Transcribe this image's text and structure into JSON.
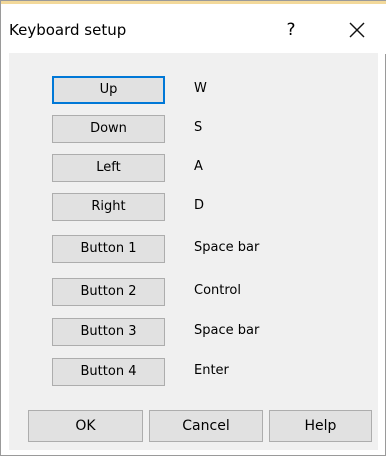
{
  "window": {
    "title": "Keyboard setup",
    "help_glyph": "?",
    "close_icon": "close-icon"
  },
  "key_bindings": [
    {
      "label": "Up",
      "value": "W"
    },
    {
      "label": "Down",
      "value": "S"
    },
    {
      "label": "Left",
      "value": "A"
    },
    {
      "label": "Right",
      "value": "D"
    },
    {
      "label": "Button 1",
      "value": "Space bar"
    },
    {
      "label": "Button 2",
      "value": "Control"
    },
    {
      "label": "Button 3",
      "value": "Space bar"
    },
    {
      "label": "Button 4",
      "value": "Enter"
    }
  ],
  "footer": {
    "ok_label": "OK",
    "cancel_label": "Cancel",
    "help_label": "Help"
  },
  "colors": {
    "focus_border": "#0078d7",
    "button_face": "#e1e1e1",
    "client_background": "#f0f0f0"
  }
}
